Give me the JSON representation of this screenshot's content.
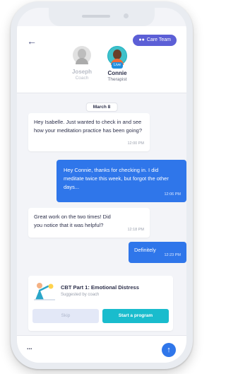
{
  "header": {
    "care_team_label": "Care Team",
    "participants": [
      {
        "name": "Joseph",
        "role": "Coach"
      },
      {
        "name": "Connie",
        "role": "Therapist",
        "badge": "Live"
      }
    ]
  },
  "date_label": "March 8",
  "messages": [
    {
      "direction": "incoming",
      "text": "Hey Isabelle. Just wanted to check in and see how your meditation practice has been going?",
      "time": "12:00 PM"
    },
    {
      "direction": "outgoing",
      "text": "Hey Connie, thanks for checking in. I did meditate twice this week, but forgot the other days...",
      "time": "12:06 PM"
    },
    {
      "direction": "incoming",
      "text": "Great work on the two times! Did you notice that it was helpful?",
      "time": "12:18 PM"
    },
    {
      "direction": "outgoing",
      "text": "Definitely",
      "time": "12:23 PM"
    }
  ],
  "program": {
    "title": "CBT Part 1: Emotional Distress",
    "subtitle": "Suggested by coach",
    "skip_label": "Skip",
    "start_label": "Start a program"
  },
  "composer": {
    "placeholder": "..."
  },
  "colors": {
    "primary": "#2f76ea",
    "accent": "#19bccd",
    "care_team": "#5c5fd6"
  }
}
